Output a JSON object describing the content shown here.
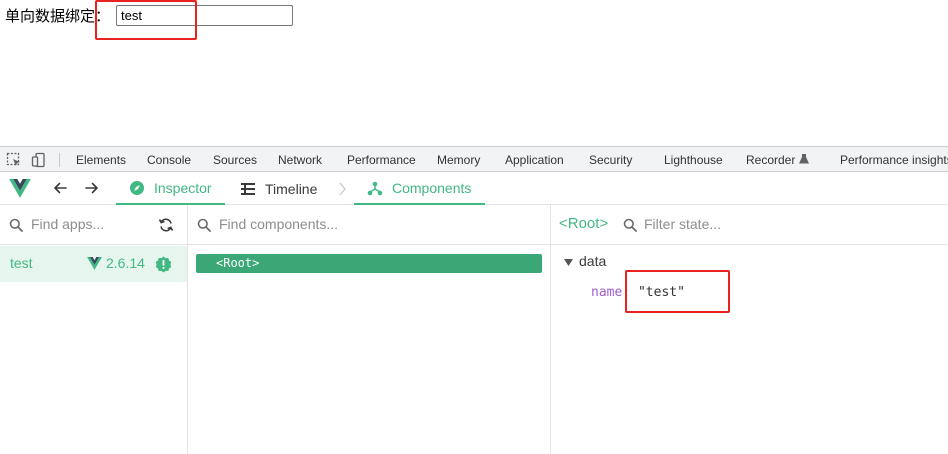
{
  "page": {
    "binding_label": "单向数据绑定：",
    "input_value": "test"
  },
  "devtools": {
    "tabs": [
      "Elements",
      "Console",
      "Sources",
      "Network",
      "Performance",
      "Memory",
      "Application",
      "Security",
      "Lighthouse",
      "Recorder",
      "Performance insights"
    ]
  },
  "vue": {
    "tabs": {
      "inspector": "Inspector",
      "timeline": "Timeline",
      "components": "Components"
    },
    "apps_search_placeholder": "Find apps...",
    "app": {
      "name": "test",
      "version": "2.6.14"
    },
    "components_search_placeholder": "Find components...",
    "root_component": "<Root>",
    "selected_component": "<Root>",
    "state_filter_placeholder": "Filter state...",
    "state": {
      "section": "data",
      "key": "name",
      "value": "\"test\""
    }
  },
  "colors": {
    "vue_green": "#42b883",
    "root_bar": "#3ba776",
    "highlight": "#e8231f",
    "key_purple": "#a15ed1"
  }
}
